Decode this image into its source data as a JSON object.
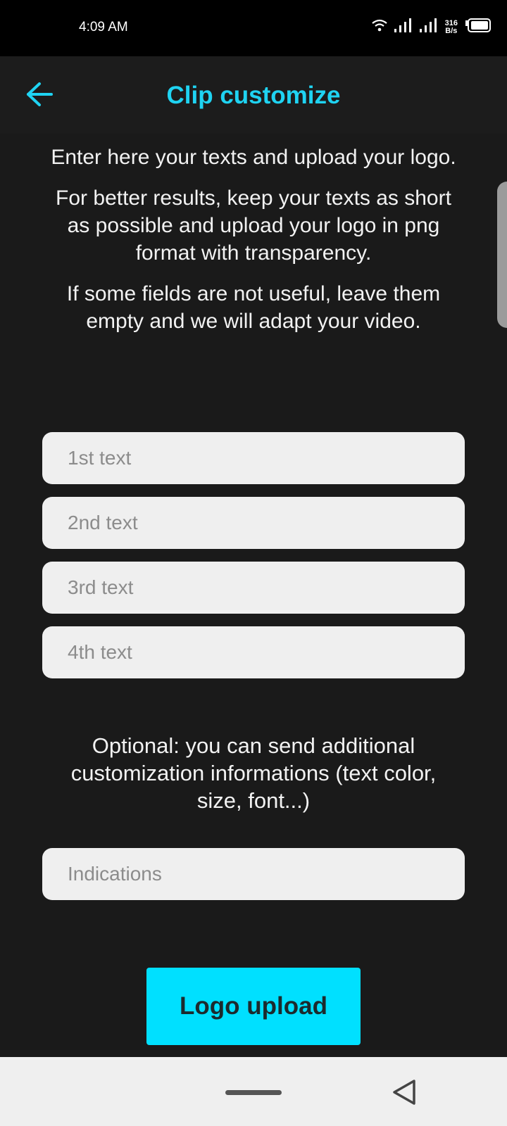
{
  "status_bar": {
    "time": "4:09 AM",
    "net_speed_value": "316",
    "net_speed_unit": "B/s",
    "icons": [
      "wifi-icon",
      "signal-icon",
      "signal-icon",
      "battery-icon"
    ]
  },
  "app_bar": {
    "title": "Clip customize",
    "back_icon": "arrow-left-icon",
    "accent_color": "#1fd3f2"
  },
  "intro": {
    "line1": "Enter here your texts and upload your logo.",
    "line2": "For better results, keep your texts as short as possible and upload your logo in png format with transparency.",
    "line3": "If some fields are not useful, leave them empty and we will adapt your video."
  },
  "fields": {
    "text1_placeholder": "1st text",
    "text2_placeholder": "2nd text",
    "text3_placeholder": "3rd text",
    "text4_placeholder": "4th text",
    "indications_placeholder": "Indications"
  },
  "optional_note": "Optional: you can send additional customization informations (text color, size, font...)",
  "logo_upload_label": "Logo upload",
  "button_color": "#00e0ff"
}
